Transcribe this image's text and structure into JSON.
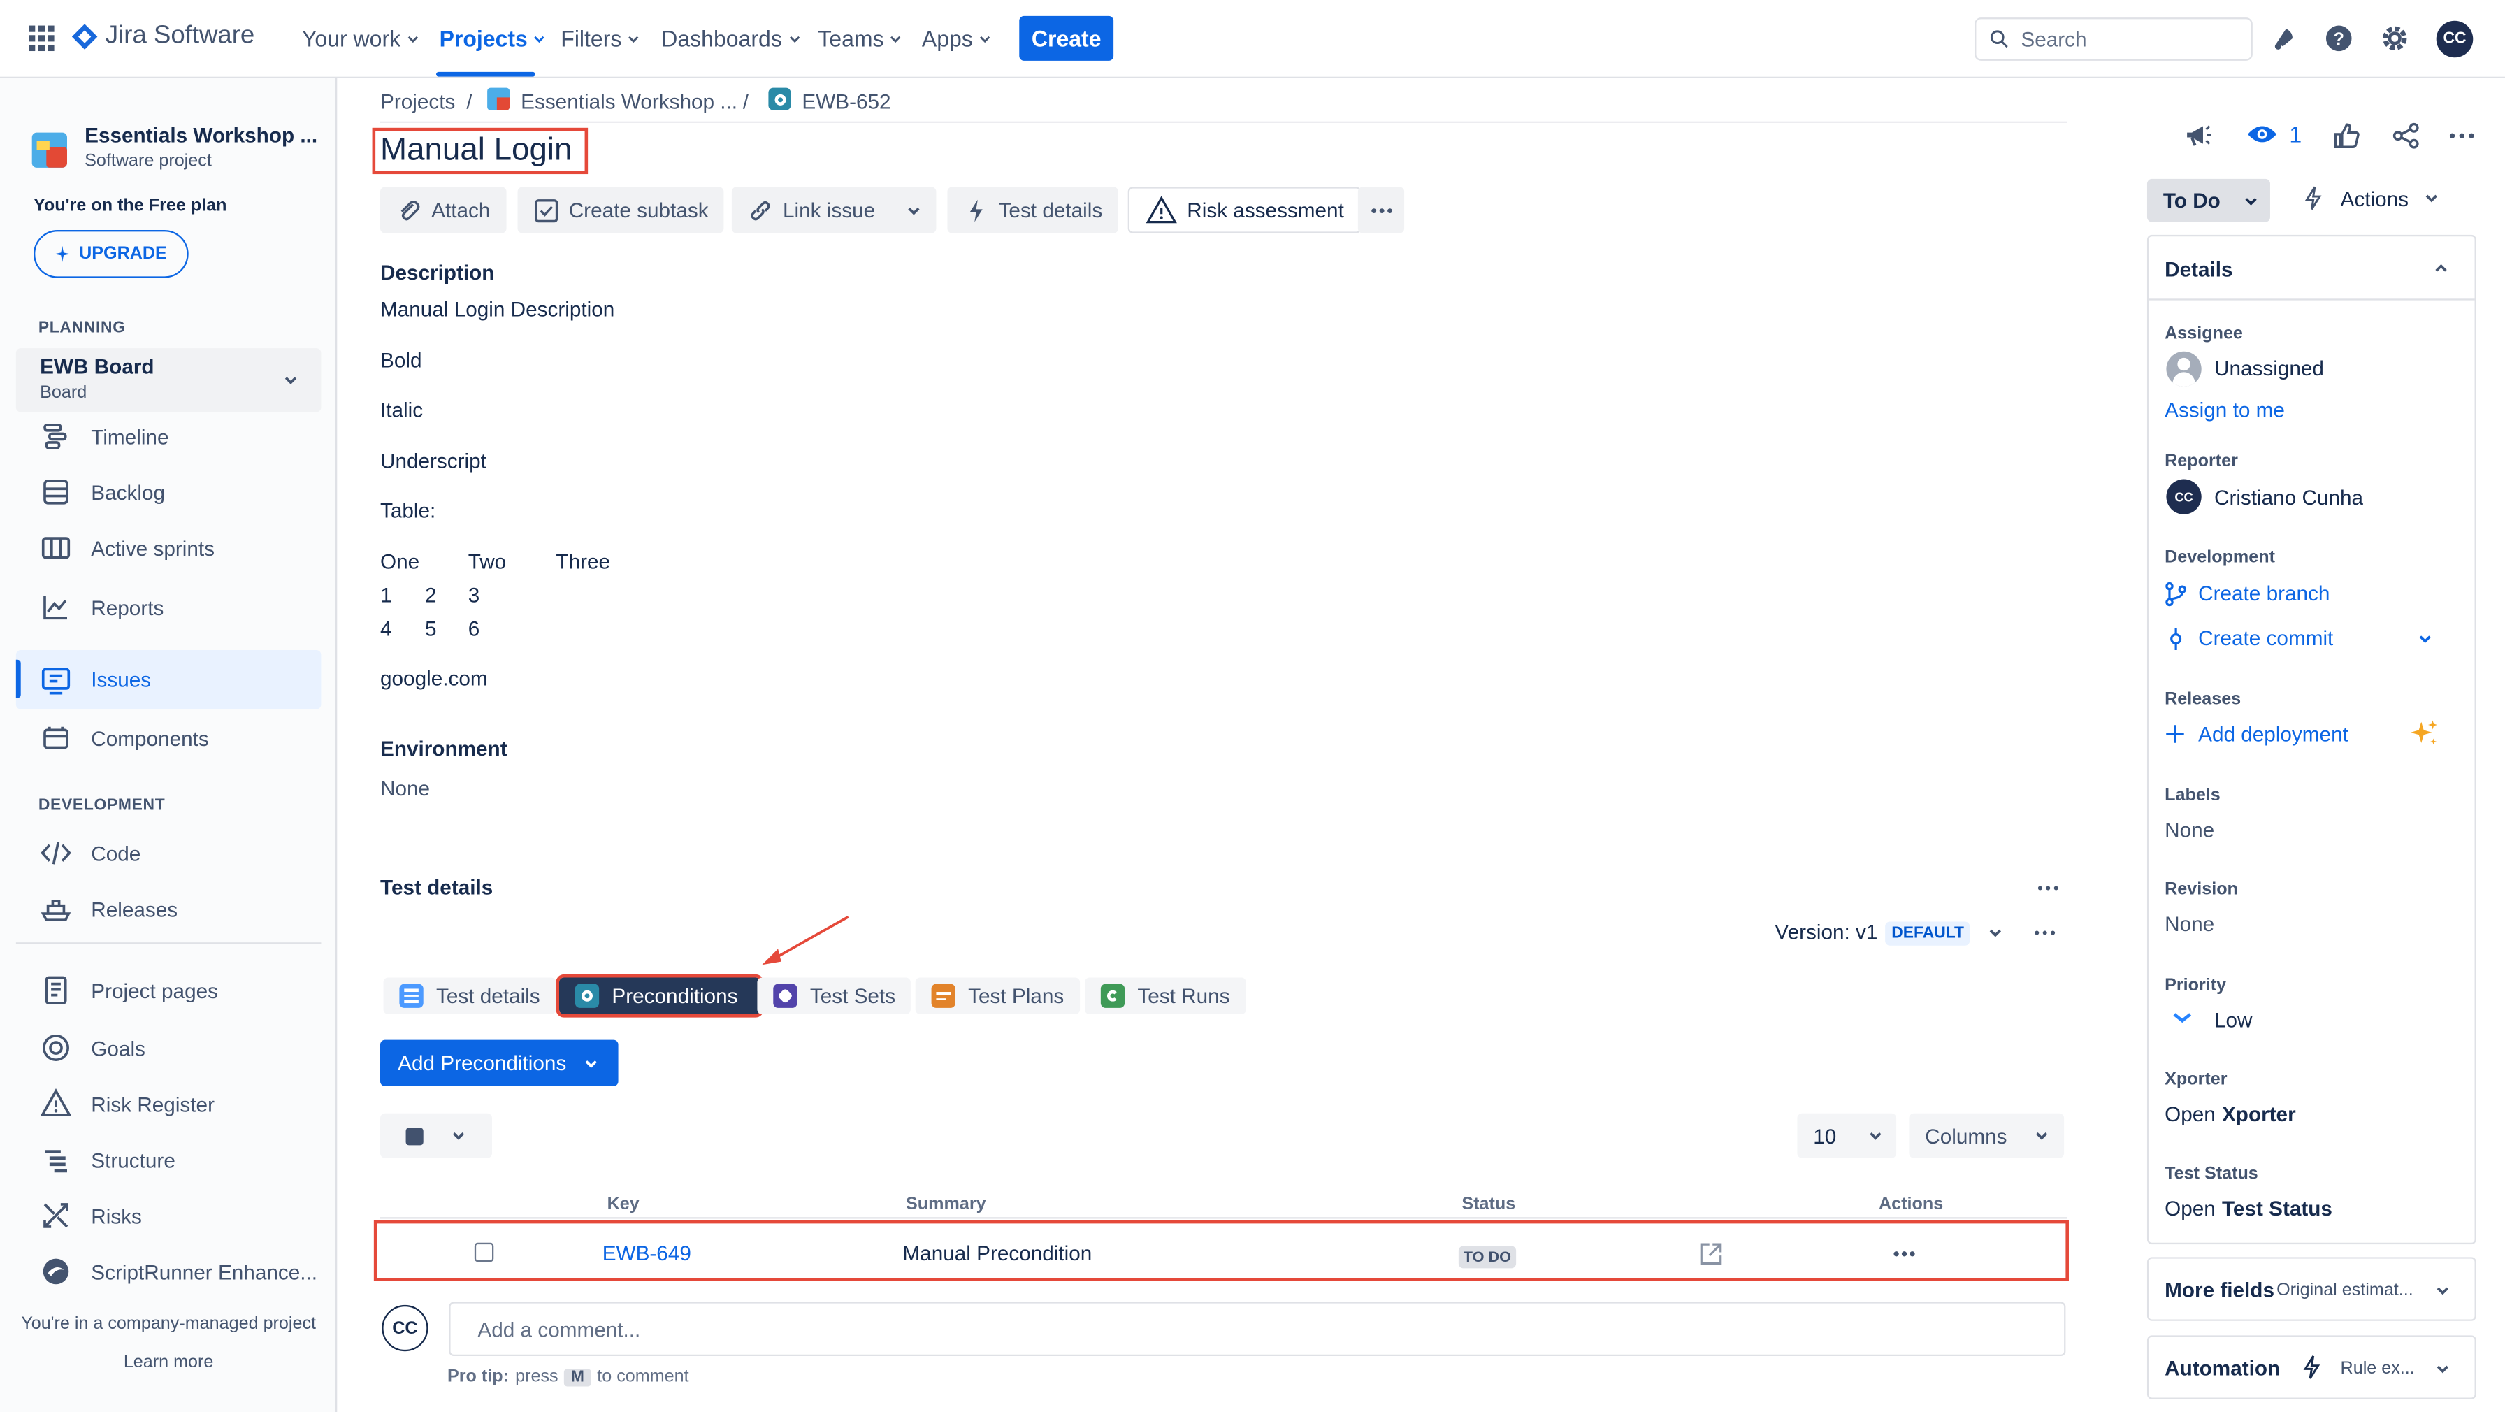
{
  "topnav": {
    "product": "Jira Software",
    "items": [
      "Your work",
      "Projects",
      "Filters",
      "Dashboards",
      "Teams",
      "Apps"
    ],
    "create_label": "Create",
    "search_placeholder": "Search",
    "user_initials": "CC"
  },
  "sidebar": {
    "project_name": "Essentials Workshop ...",
    "project_type": "Software project",
    "plan_text": "You're on the Free plan",
    "upgrade_label": "UPGRADE",
    "planning_heading": "PLANNING",
    "board_name": "EWB Board",
    "board_type": "Board",
    "planning_items": [
      "Timeline",
      "Backlog",
      "Active sprints",
      "Reports",
      "Issues",
      "Components"
    ],
    "development_heading": "DEVELOPMENT",
    "development_items": [
      "Code",
      "Releases"
    ],
    "other_items": [
      "Project pages",
      "Goals",
      "Risk Register",
      "Structure",
      "Risks",
      "ScriptRunner Enhance..."
    ],
    "footer_text": "You're in a company-managed project",
    "learn_more": "Learn more"
  },
  "breadcrumb": {
    "projects": "Projects",
    "separator": "/",
    "project": "Essentials Workshop ...",
    "issue_key": "EWB-652"
  },
  "issue": {
    "title": "Manual Login",
    "toolbar": {
      "attach": "Attach",
      "create_subtask": "Create subtask",
      "link_issue": "Link issue",
      "test_details": "Test details",
      "risk_assessment": "Risk assessment"
    },
    "description_heading": "Description",
    "description_lines": [
      "Manual Login Description",
      "Bold",
      "Italic",
      "Underscript",
      "Table:"
    ],
    "table_header": [
      "One",
      "Two",
      "Three"
    ],
    "table_rows": [
      [
        "1",
        "2",
        "3"
      ],
      [
        "4",
        "5",
        "6"
      ]
    ],
    "link_text": "google.com",
    "environment_heading": "Environment",
    "environment_value": "None"
  },
  "test_details": {
    "heading": "Test details",
    "version_label": "Version: v1",
    "default_badge": "DEFAULT",
    "tabs": [
      "Test details",
      "Preconditions",
      "Test Sets",
      "Test Plans",
      "Test Runs"
    ],
    "active_tab": "Preconditions",
    "add_button": "Add Preconditions",
    "page_size": "10",
    "columns_label": "Columns",
    "table_headers": [
      "Key",
      "Summary",
      "Status",
      "Actions"
    ],
    "rows": [
      {
        "key": "EWB-649",
        "summary": "Manual Precondition",
        "status": "TO DO"
      }
    ]
  },
  "comment": {
    "avatar": "CC",
    "placeholder": "Add a comment...",
    "tip_prefix": "Pro tip:",
    "tip_press": "press",
    "tip_key": "M",
    "tip_suffix": "to comment"
  },
  "right_panel": {
    "watch_count": "1",
    "status_button": "To Do",
    "actions_label": "Actions",
    "details_heading": "Details",
    "assignee_label": "Assignee",
    "assignee_value": "Unassigned",
    "assign_to_me": "Assign to me",
    "reporter_label": "Reporter",
    "reporter_initials": "CC",
    "reporter_value": "Cristiano Cunha",
    "development_label": "Development",
    "create_branch": "Create branch",
    "create_commit": "Create commit",
    "releases_label": "Releases",
    "add_deployment": "Add deployment",
    "labels_label": "Labels",
    "labels_value": "None",
    "revision_label": "Revision",
    "revision_value": "None",
    "priority_label": "Priority",
    "priority_value": "Low",
    "xporter_label": "Xporter",
    "xporter_open": "Open",
    "xporter_value": "Xporter",
    "test_status_label": "Test Status",
    "test_status_open": "Open",
    "test_status_value": "Test Status",
    "more_fields": "More fields",
    "more_fields_hint": "Original estimat...",
    "automation": "Automation",
    "automation_hint": "Rule ex..."
  },
  "colors": {
    "brand_blue": "#0c66e4",
    "highlight_red": "#e5493a",
    "active_tab_bg": "#253858"
  }
}
